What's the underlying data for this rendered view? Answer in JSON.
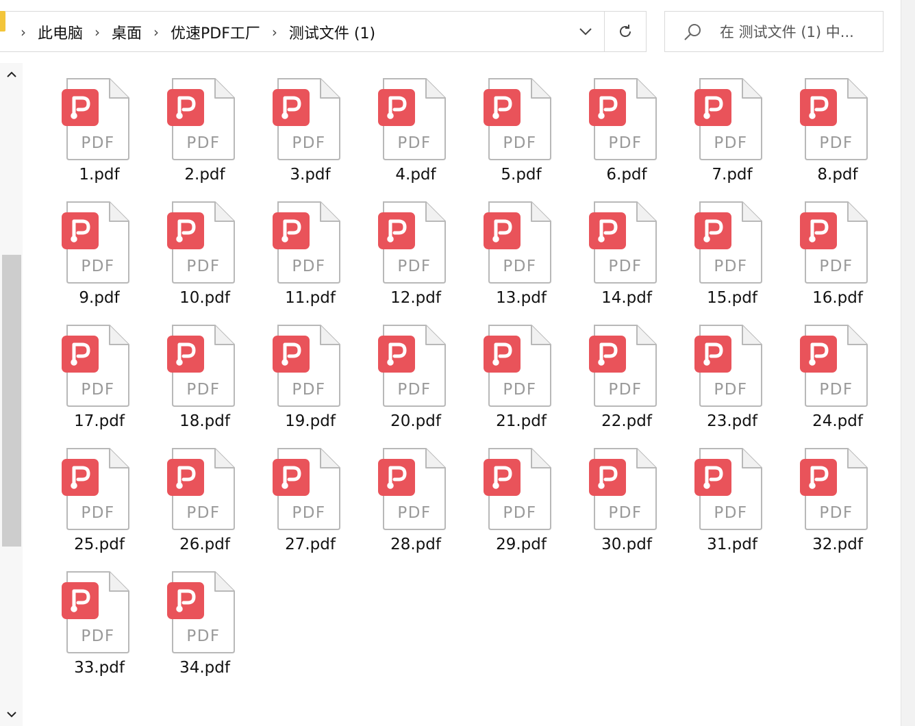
{
  "address_bar": {
    "breadcrumbs": [
      "此电脑",
      "桌面",
      "优速PDF工厂",
      "测试文件 (1)"
    ]
  },
  "search": {
    "placeholder": "在 测试文件 (1) 中..."
  },
  "file_type_badge": "PDF",
  "colors": {
    "pdf_badge_red": "#e9535a",
    "page_border": "#b8b8b8",
    "folder_yellow": "#f3c53a"
  },
  "icons": [
    "folder-icon",
    "chevron-right-icon",
    "chevron-down-icon",
    "refresh-icon",
    "search-icon",
    "pdf-file-icon",
    "scroll-up-icon",
    "scroll-down-icon"
  ],
  "files": [
    {
      "name": "1.pdf"
    },
    {
      "name": "2.pdf"
    },
    {
      "name": "3.pdf"
    },
    {
      "name": "4.pdf"
    },
    {
      "name": "5.pdf"
    },
    {
      "name": "6.pdf"
    },
    {
      "name": "7.pdf"
    },
    {
      "name": "8.pdf"
    },
    {
      "name": "9.pdf"
    },
    {
      "name": "10.pdf"
    },
    {
      "name": "11.pdf"
    },
    {
      "name": "12.pdf"
    },
    {
      "name": "13.pdf"
    },
    {
      "name": "14.pdf"
    },
    {
      "name": "15.pdf"
    },
    {
      "name": "16.pdf"
    },
    {
      "name": "17.pdf"
    },
    {
      "name": "18.pdf"
    },
    {
      "name": "19.pdf"
    },
    {
      "name": "20.pdf"
    },
    {
      "name": "21.pdf"
    },
    {
      "name": "22.pdf"
    },
    {
      "name": "23.pdf"
    },
    {
      "name": "24.pdf"
    },
    {
      "name": "25.pdf"
    },
    {
      "name": "26.pdf"
    },
    {
      "name": "27.pdf"
    },
    {
      "name": "28.pdf"
    },
    {
      "name": "29.pdf"
    },
    {
      "name": "30.pdf"
    },
    {
      "name": "31.pdf"
    },
    {
      "name": "32.pdf"
    },
    {
      "name": "33.pdf"
    },
    {
      "name": "34.pdf"
    }
  ]
}
